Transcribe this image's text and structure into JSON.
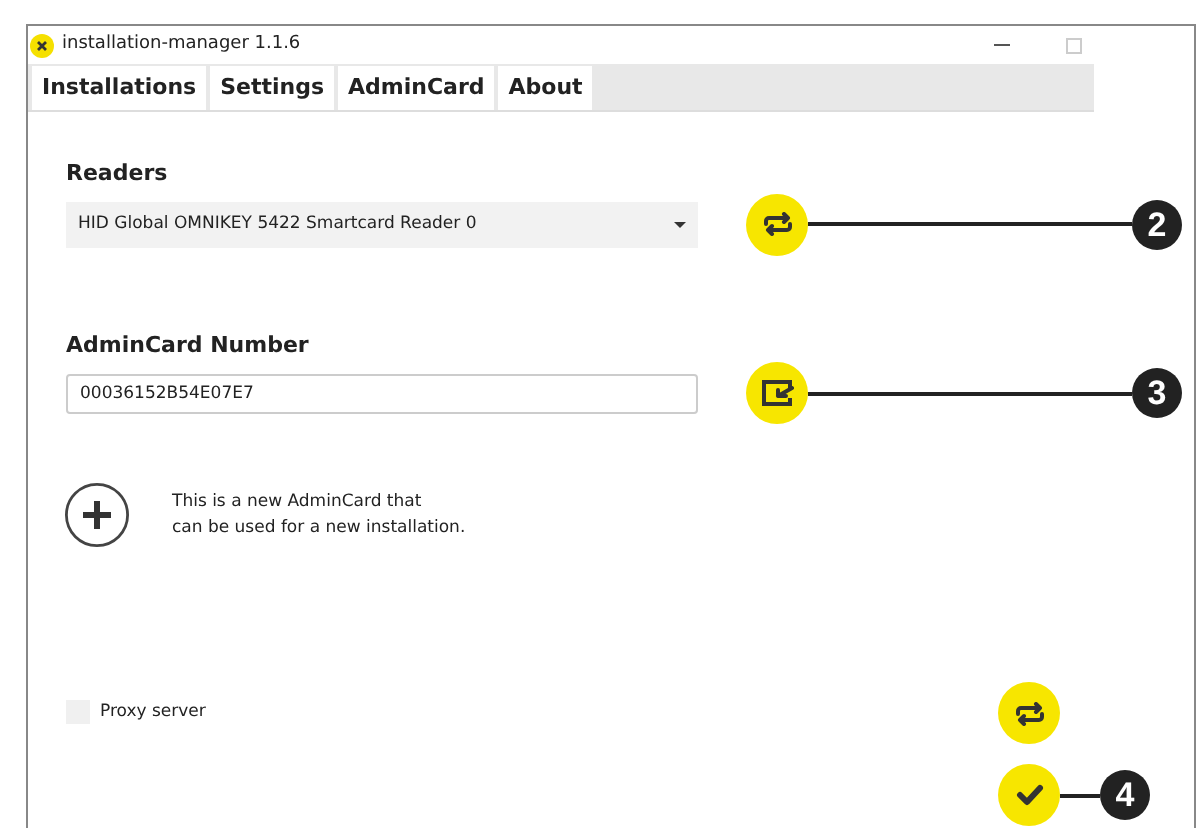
{
  "window": {
    "title": "installation-manager 1.1.6"
  },
  "tabs": [
    {
      "label": "Installations"
    },
    {
      "label": "Settings"
    },
    {
      "label": "AdminCard"
    },
    {
      "label": "About"
    }
  ],
  "readers": {
    "label": "Readers",
    "value": "HID Global OMNIKEY 5422 Smartcard Reader 0",
    "callout": "2"
  },
  "admincard": {
    "label": "AdminCard Number",
    "value": "00036152B54E07E7",
    "callout": "3"
  },
  "new_card": {
    "text": "This is a new AdminCard that\ncan be used for a new installation."
  },
  "proxy": {
    "label": "Proxy server",
    "checked": false
  },
  "confirm": {
    "callout": "4"
  }
}
